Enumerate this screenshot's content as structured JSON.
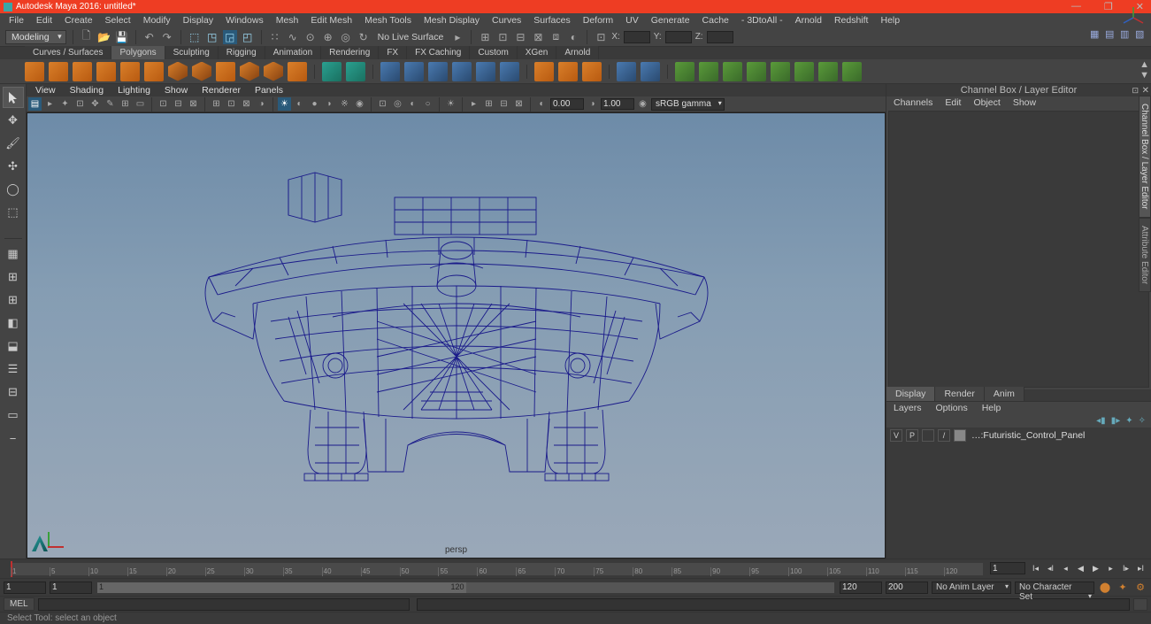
{
  "title": "Autodesk Maya 2016: untitled*",
  "menubar": [
    "File",
    "Edit",
    "Create",
    "Select",
    "Modify",
    "Display",
    "Windows",
    "Mesh",
    "Edit Mesh",
    "Mesh Tools",
    "Mesh Display",
    "Curves",
    "Surfaces",
    "Deform",
    "UV",
    "Generate",
    "Cache",
    "- 3DtoAll -",
    "Arnold",
    "Redshift",
    "Help"
  ],
  "workspace_dropdown": "Modeling",
  "live_surface": "No Live Surface",
  "xyz": {
    "x_label": "X:",
    "x_val": "",
    "y_label": "Y:",
    "y_val": "",
    "z_label": "Z:",
    "z_val": ""
  },
  "shelf_tabs": [
    "Curves / Surfaces",
    "Polygons",
    "Sculpting",
    "Rigging",
    "Animation",
    "Rendering",
    "FX",
    "FX Caching",
    "Custom",
    "XGen",
    "Arnold"
  ],
  "active_shelf": 1,
  "panel_menu": [
    "View",
    "Shading",
    "Lighting",
    "Show",
    "Renderer",
    "Panels"
  ],
  "vp_num1": "0.00",
  "vp_num2": "1.00",
  "vp_colorspace": "sRGB gamma",
  "viewport_name": "persp",
  "channel_title": "Channel Box / Layer Editor",
  "channel_menu": [
    "Channels",
    "Edit",
    "Object",
    "Show"
  ],
  "layer_tabs": [
    "Display",
    "Render",
    "Anim"
  ],
  "layer_sub": [
    "Layers",
    "Options",
    "Help"
  ],
  "layer": {
    "v": "V",
    "p": "P",
    "slash": "/",
    "name": "…:Futuristic_Control_Panel"
  },
  "right_tabs": [
    "Channel Box / Layer Editor",
    "Attribute Editor"
  ],
  "timeline_ticks": [
    "1",
    "5",
    "10",
    "15",
    "20",
    "25",
    "30",
    "35",
    "40",
    "45",
    "50",
    "55",
    "60",
    "65",
    "70",
    "75",
    "80",
    "85",
    "90",
    "95",
    "100",
    "105",
    "110",
    "115",
    "120"
  ],
  "range": {
    "start_outer": "1",
    "start_inner": "1",
    "track_l": "1",
    "track_r": "120",
    "end_inner": "120",
    "end_outer": "200",
    "anim_layer": "No Anim Layer",
    "char_set": "No Character Set"
  },
  "timeline_end_field": "1",
  "cmd_label": "MEL",
  "helpline": "Select Tool: select an object"
}
